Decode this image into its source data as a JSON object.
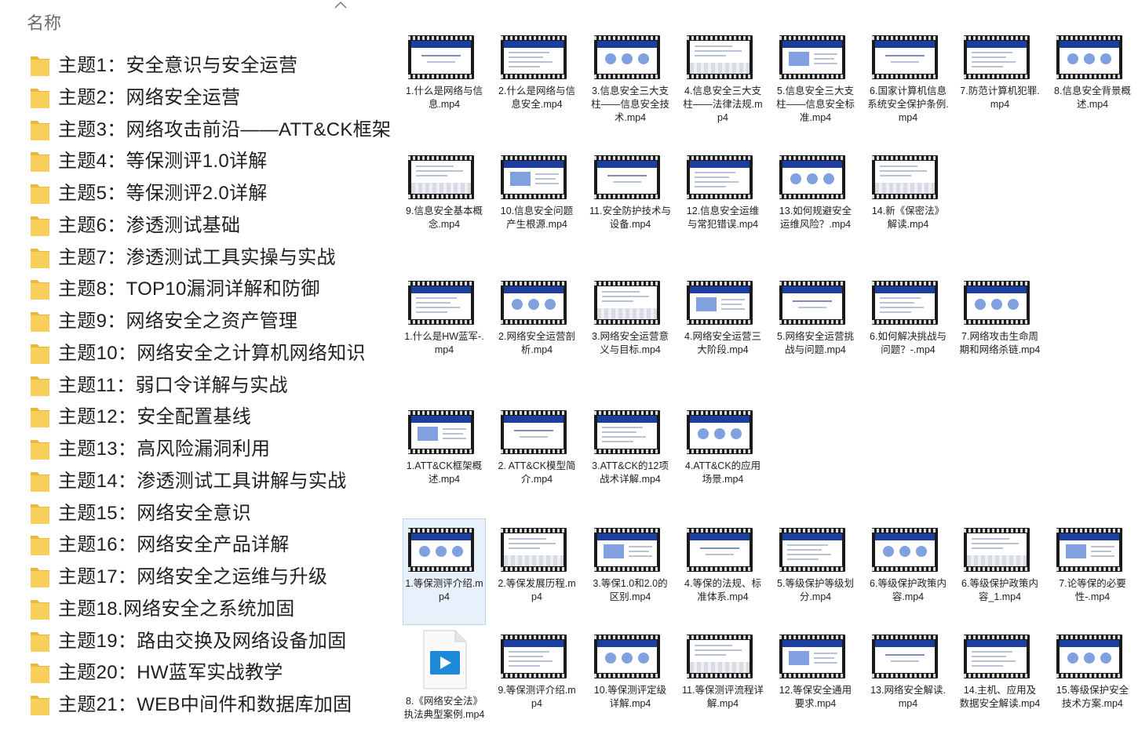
{
  "header": {
    "column_name": "名称"
  },
  "folders": [
    "主题1：安全意识与安全运营",
    "主题2：网络安全运营",
    "主题3：网络攻击前沿——ATT&CK框架",
    "主题4：等保测评1.0详解",
    "主题5：等保测评2.0详解",
    "主题6：渗透测试基础",
    "主题7：渗透测试工具实操与实战",
    "主题8：TOP10漏洞详解和防御",
    "主题9：网络安全之资产管理",
    "主题10：网络安全之计算机网络知识",
    "主题11：弱口令详解与实战",
    "主题12：安全配置基线",
    "主题13：高风险漏洞利用",
    "主题14：渗透测试工具讲解与实战",
    "主题15：网络安全意识",
    "主题16：网络安全产品详解",
    "主题17：网络安全之运维与升级",
    "主题18.网络安全之系统加固",
    "主题19：路由交换及网络设备加固",
    "主题20：HW蓝军实战教学",
    "主题21：WEB中间件和数据库加固"
  ],
  "file_rows": [
    [
      "1.什么是网络与信息.mp4",
      "2.什么是网络与信息安全.mp4",
      "3.信息安全三大支柱——信息安全技术.mp4",
      "4.信息安全三大支柱——法律法规.mp4",
      "5.信息安全三大支柱——信息安全标准.mp4",
      "6.国家计算机信息系统安全保护条例.mp4",
      "7.防范计算机犯罪.mp4",
      "8.信息安全背景概述.mp4"
    ],
    [
      "9.信息安全基本概念.mp4",
      "10.信息安全问题产生根源.mp4",
      "11.安全防护技术与设备.mp4",
      "12.信息安全运维与常犯错误.mp4",
      "13.如何规避安全运维风险？.mp4",
      "14.新《保密法》解读.mp4"
    ],
    [
      "1.什么是HW蓝军-.mp4",
      "2.网络安全运营剖析.mp4",
      "3.网络安全运营意义与目标.mp4",
      "4.网络安全运营三大阶段.mp4",
      "5.网络安全运营挑战与问题.mp4",
      "6.如何解决挑战与问题？-.mp4",
      "7.网络攻击生命周期和网络杀链.mp4"
    ],
    [
      "1.ATT&CK框架概述.mp4",
      "2.  ATT&CK模型简介.mp4",
      "3.ATT&CK的12项战术详解.mp4",
      "4.ATT&CK的应用场景.mp4"
    ],
    [
      "1.等保测评介绍.mp4",
      "2.等保发展历程.mp4",
      "3.等保1.0和2.0的区别.mp4",
      "4.等保的法规、标准体系.mp4",
      "5.等级保护等级划分.mp4",
      "6.等级保护政策内容.mp4",
      "6.等级保护政策内容_1.mp4",
      "7.论等保的必要性-.mp4"
    ],
    [
      "8.《网络安全法》执法典型案例.mp4",
      "9.等保测评介绍.mp4",
      "10.等保测评定级详解.mp4",
      "11.等保测评流程详解.mp4",
      "12.等保安全通用要求.mp4",
      "13.网络安全解读.mp4",
      "14.主机、应用及数据安全解读.mp4",
      "15.等级保护安全技术方案.mp4"
    ]
  ],
  "colors": {
    "folder": "#f8cf5a",
    "selection": "#e8f1fb",
    "slide_bar": "#1a3f9e",
    "text": "#1f1f1f"
  }
}
